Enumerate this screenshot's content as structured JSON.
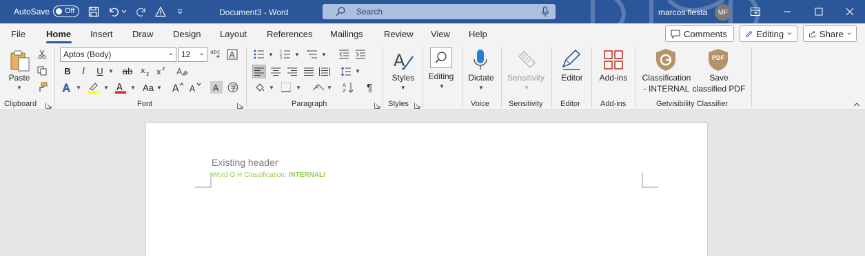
{
  "titlebar": {
    "autosave_label": "AutoSave",
    "autosave_state": "Off",
    "document_title": "Document3  -  Word",
    "search_placeholder": "Search",
    "user_name": "marcos  fiesta",
    "user_initials": "MF",
    "bg_color": "#2b579a"
  },
  "menu": {
    "items": [
      "File",
      "Home",
      "Insert",
      "Draw",
      "Design",
      "Layout",
      "References",
      "Mailings",
      "Review",
      "View",
      "Help"
    ],
    "active": "Home",
    "comments_label": "Comments",
    "editing_label": "Editing",
    "share_label": "Share"
  },
  "ribbon": {
    "clipboard": {
      "paste_label": "Paste",
      "group_label": "Clipboard"
    },
    "font": {
      "font_name": "Aptos (Body)",
      "font_size": "12",
      "group_label": "Font",
      "change_case": "Aa"
    },
    "paragraph": {
      "group_label": "Paragraph"
    },
    "styles": {
      "styles_label": "Styles",
      "group_label": "Styles"
    },
    "editing": {
      "editing_label": "Editing"
    },
    "voice": {
      "dictate_label": "Dictate",
      "group_label": "Voice"
    },
    "sensitivity": {
      "sensitivity_label": "Sensitivity",
      "group_label": "Sensitivity"
    },
    "editor": {
      "editor_label": "Editor",
      "group_label": "Editor"
    },
    "addins": {
      "addins_label": "Add-ins",
      "group_label": "Add-ins"
    },
    "getvisibility": {
      "classification_line1": "Classification",
      "classification_line2": "- INTERNAL",
      "save_line1": "Save",
      "save_line2": "classified PDF",
      "pdf_badge": "PDF",
      "group_label": "Getvisibility Classifier"
    }
  },
  "document": {
    "existing_header": "Existing header",
    "classification_prefix": "Word O H Classification: ",
    "classification_value": "INTERNAL/",
    "classification_color": "#92d050"
  }
}
